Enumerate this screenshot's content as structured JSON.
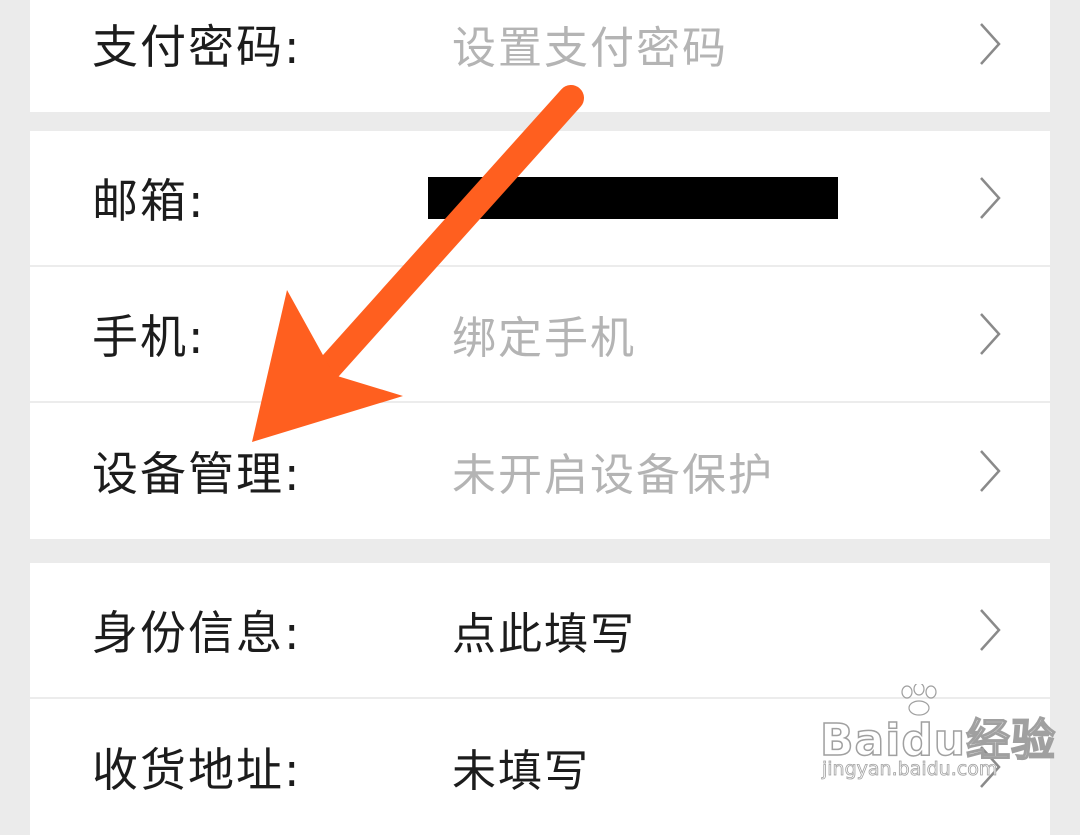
{
  "groups": [
    {
      "rows": [
        {
          "label": "支付密码:",
          "value": "设置支付密码",
          "tone": "muted"
        }
      ]
    },
    {
      "rows": [
        {
          "label": "邮箱:",
          "value": "",
          "redacted": true
        },
        {
          "label": "手机:",
          "value": "绑定手机",
          "tone": "muted"
        },
        {
          "label": "设备管理:",
          "value": "未开启设备保护",
          "tone": "muted"
        }
      ]
    },
    {
      "rows": [
        {
          "label": "身份信息:",
          "value": "点此填写",
          "tone": "dark"
        },
        {
          "label": "收货地址:",
          "value": "未填写",
          "tone": "dark"
        }
      ]
    }
  ],
  "icons": {
    "row_arrow": "chevron-right-icon",
    "annotation": "arrow-pointer-icon"
  },
  "colors": {
    "annotation_arrow": "#ff5f1f",
    "muted_text": "#b4b4b4",
    "label_text": "#1c1c1c"
  },
  "watermark": {
    "brand": "Bai",
    "brand2": "du",
    "brand_cn": "经验",
    "url": "jingyan.baidu.com"
  }
}
